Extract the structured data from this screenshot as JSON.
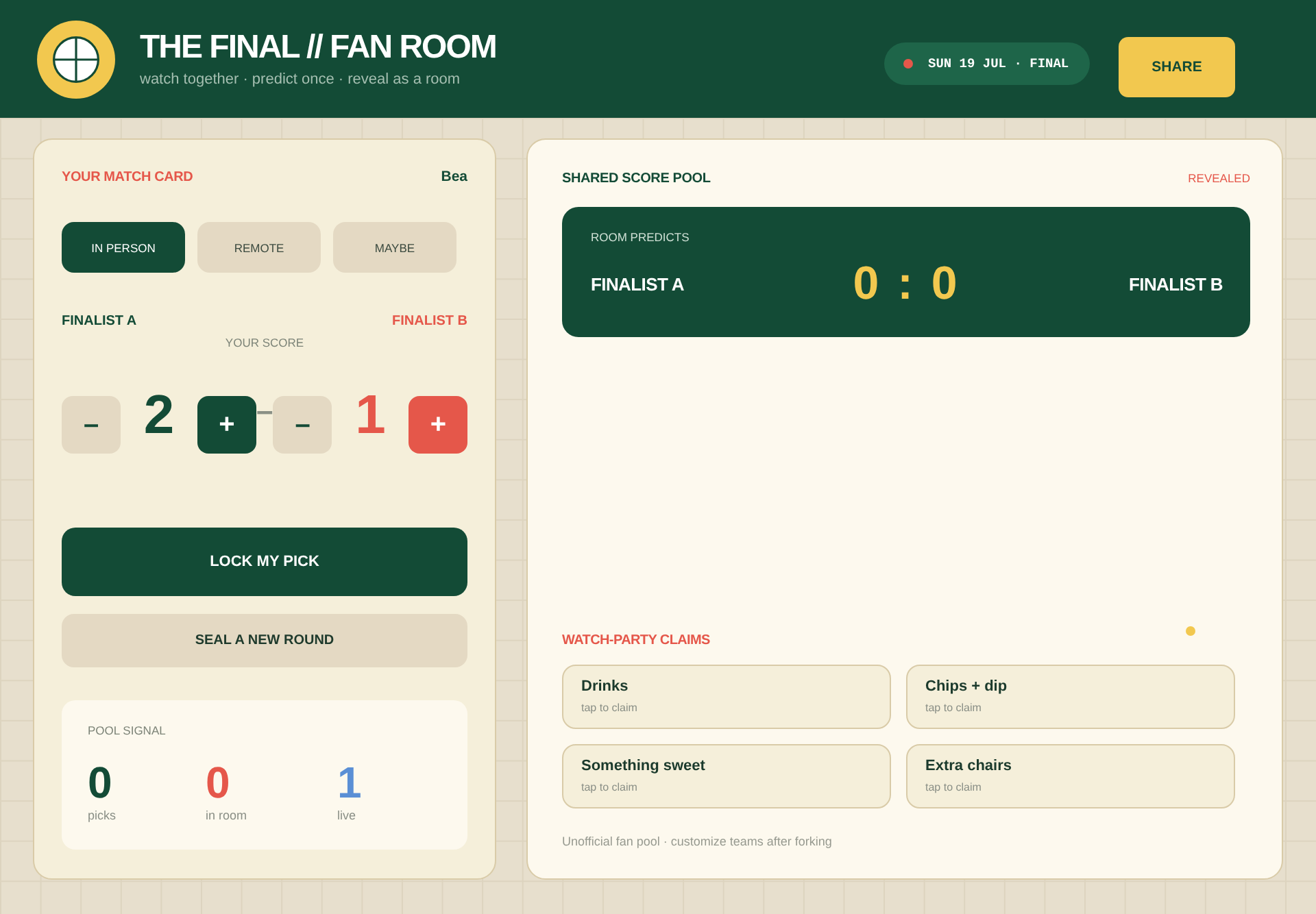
{
  "header": {
    "title": "THE FINAL // FAN ROOM",
    "subtitle": "watch together · predict once · reveal as a room",
    "date_badge": "SUN 19 JUL · FINAL",
    "share_button": "SHARE"
  },
  "match_card": {
    "title": "YOUR MATCH CARD",
    "user": "Bea",
    "attendance": [
      {
        "label": "IN PERSON",
        "selected": true
      },
      {
        "label": "REMOTE",
        "selected": false
      },
      {
        "label": "MAYBE",
        "selected": false
      }
    ],
    "score_label": "YOUR SCORE",
    "score_separator": "–",
    "sides": [
      {
        "kind": "home",
        "team": "FINALIST A",
        "minus": "–",
        "score": "2",
        "plus": "+"
      },
      {
        "kind": "away",
        "team": "FINALIST B",
        "minus": "–",
        "score": "1",
        "plus": "+"
      }
    ],
    "lock_button": "LOCK MY PICK",
    "new_round_button": "SEAL A NEW ROUND",
    "pool_signal": {
      "title": "POOL SIGNAL",
      "stats": [
        {
          "value": "0",
          "label": "picks",
          "color": "#134b36"
        },
        {
          "value": "0",
          "label": "in room",
          "color": "#e5574a"
        },
        {
          "value": "1",
          "label": "live",
          "color": "#5a8fd5"
        }
      ]
    }
  },
  "score_pool": {
    "title": "SHARED SCORE POOL",
    "status": "REVEALED",
    "board": {
      "label": "ROOM PREDICTS",
      "team_a": "FINALIST A",
      "score": "0 : 0",
      "team_b": "FINALIST B"
    },
    "claims": {
      "title": "WATCH-PARTY CLAIMS",
      "items": [
        {
          "name": "Drinks",
          "hint": "tap to claim"
        },
        {
          "name": "Chips + dip",
          "hint": "tap to claim"
        },
        {
          "name": "Something sweet",
          "hint": "tap to claim"
        },
        {
          "name": "Extra chairs",
          "hint": "tap to claim"
        }
      ]
    },
    "footer": "Unofficial fan pool · customize teams after forking"
  }
}
